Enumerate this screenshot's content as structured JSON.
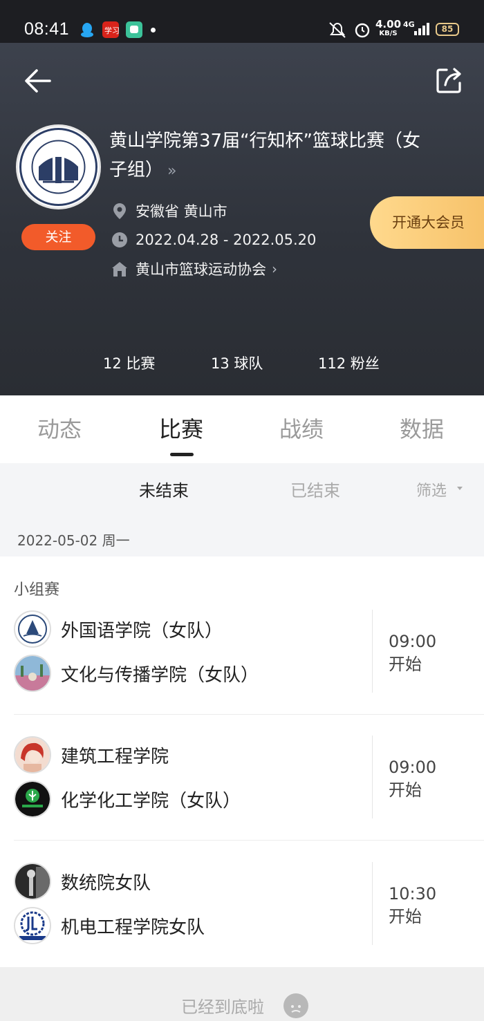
{
  "status_bar": {
    "time": "08:41",
    "net_speed_value": "4.00",
    "net_speed_unit": "KB/S",
    "network": "4G",
    "battery": "85"
  },
  "header": {
    "title_line1": "黄山学院第37届“行知杯”篮球比赛（女",
    "title_line2": "子组）",
    "more_symbol": "»",
    "follow_label": "关注",
    "location": "安徽省 黄山市",
    "date_range": "2022.04.28 - 2022.05.20",
    "organizer": "黄山市篮球运动协会",
    "vip_label": "开通大会员",
    "stats": {
      "matches": "12 比赛",
      "teams": "13 球队",
      "fans": "112 粉丝"
    }
  },
  "tabs": [
    "动态",
    "比赛",
    "战绩",
    "数据"
  ],
  "sub_tabs": {
    "unfinished": "未结束",
    "finished": "已结束",
    "filter": "筛选"
  },
  "date_label": "2022-05-02 周一",
  "group_label": "小组赛",
  "matches": [
    {
      "team1": "外国语学院（女队）",
      "team2": "文化与传播学院（女队）",
      "time": "09:00",
      "status": "开始"
    },
    {
      "team1": "建筑工程学院",
      "team2": "化学化工学院（女队）",
      "time": "09:00",
      "status": "开始"
    },
    {
      "team1": "数统院女队",
      "team2": "机电工程学院女队",
      "time": "10:30",
      "status": "开始"
    }
  ],
  "bottom_text": "已经到底啦",
  "colors": {
    "header_bg": "#33373f",
    "follow": "#f25b2a",
    "vip": "#f6c067",
    "active_tab": "#222222"
  }
}
